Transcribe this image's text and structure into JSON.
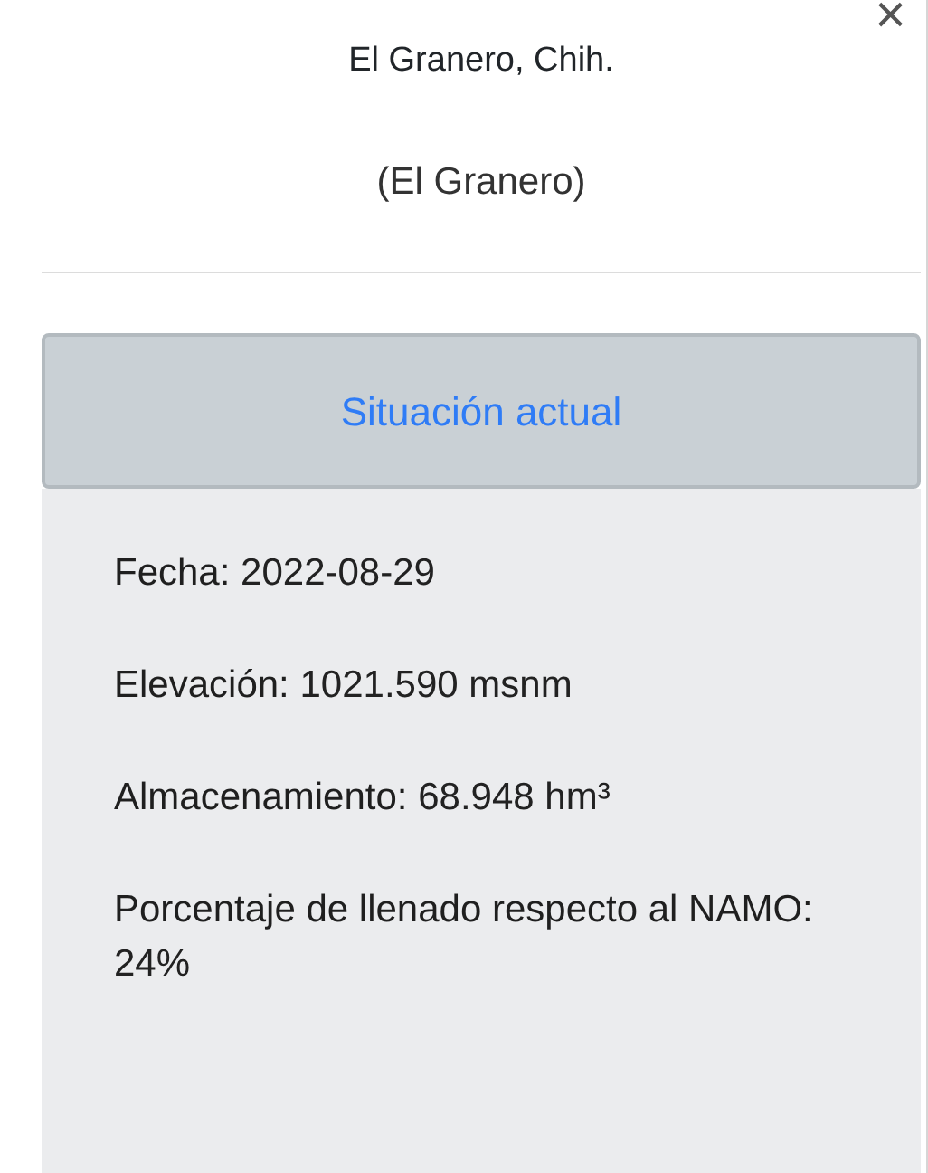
{
  "dialog": {
    "close": "×",
    "title": "El Granero, Chih.",
    "subtitle": "(El Granero)"
  },
  "section": {
    "heading": "Situación actual",
    "expanded": true,
    "fields": [
      {
        "label": "Fecha:",
        "value": "2022-08-29"
      },
      {
        "label": "Elevación:",
        "value": "1021.590 msnm"
      },
      {
        "label": "Almacenamiento:",
        "value": "68.948 hm³"
      },
      {
        "label": "Porcentaje de llenado respecto al NAMO:",
        "value": "24%"
      }
    ]
  }
}
